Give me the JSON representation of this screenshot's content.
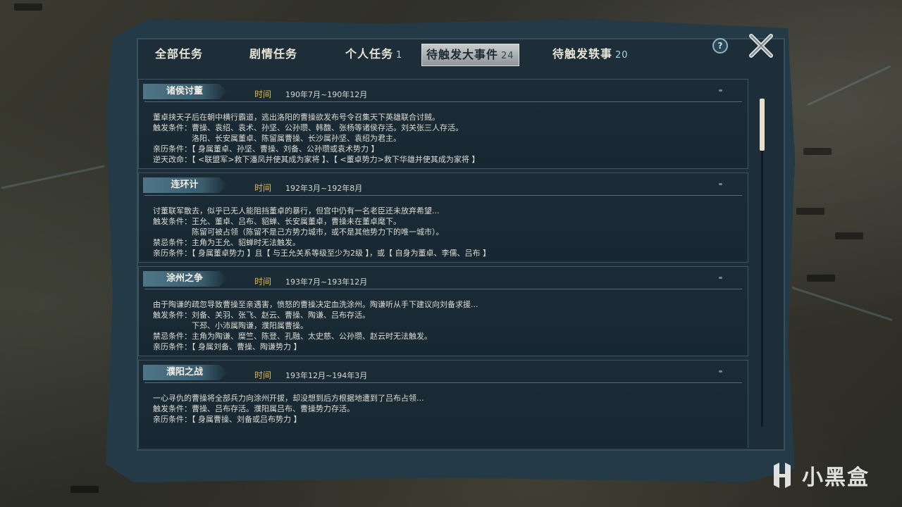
{
  "tabs": [
    {
      "label": "全部任务",
      "count": ""
    },
    {
      "label": "剧情任务",
      "count": ""
    },
    {
      "label": "个人任务",
      "count": "1"
    },
    {
      "label": "待触发大事件",
      "count": "24",
      "active": true
    },
    {
      "label": "待触发轶事",
      "count": "20"
    }
  ],
  "help_label": "?",
  "time_label": "时间",
  "events": [
    {
      "title": "诸侯讨董",
      "time": "190年7月~190年12月",
      "lines": [
        "董卓挟天子后在朝中横行霸道，逃出洛阳的曹操欲发布号令召集天下英雄联合讨贼。",
        "触发条件：曹操、袁绍、袁术、孙坚、公孙瓒、韩馥、张杨等诸侯存活。刘关张三人存活。",
        "　　　　　洛阳、长安属董卓、陈留属曹操、长沙属孙坚、袁绍为君主。",
        "亲历条件：【 身属董卓、孙坚、曹操、刘备、公孙瓒或袁术势力 】",
        "逆天改命：【 <联盟军>救下潘凤并使其成为家将 】、【 <董卓势力>救下华雄并使其成为家将 】"
      ]
    },
    {
      "title": "连环计",
      "time": "192年3月~192年8月",
      "lines": [
        "讨董联军散去，似乎已无人能阻挡董卓的暴行，但宫中仍有一名老臣还未放弃希望...",
        "触发条件：王允、董卓、吕布、貂蝉、长安属董卓，曹操未在董卓麾下。",
        "　　　　　陈留可被占领（陈留不是己方势力城市，或不是其他势力下的唯一城市）。",
        "禁忌条件：主角为王允、貂蝉时无法触发。",
        "亲历条件：【 身属董卓势力 】且【 与王允关系等级至少为2级 】，或【 自身为董卓、李儒、吕布 】"
      ]
    },
    {
      "title": "涂州之争",
      "time": "193年7月~193年12月",
      "lines": [
        "由于陶谦的疏忽导致曹操至亲遇害，愤怒的曹操决定血洗涂州。陶谦听从手下建议向刘备求援...",
        "触发条件：刘备、关羽、张飞、赵云、曹操、陶谦、吕布存活。",
        "　　　　　下邳、小沛属陶谦，濮阳属曹操。",
        "禁忌条件：主角为陶谦、糜竺、陈登、孔融、太史慈、公孙瓒、赵云时无法触发。",
        "亲历条件：【 身属刘备、曹操、陶谦势力 】"
      ]
    },
    {
      "title": "濮阳之战",
      "time": "193年12月~194年3月",
      "lines": [
        "一心寻仇的曹操将全部兵力向涂州开拔，却没想到后方根据地遭到了吕布占领...",
        "触发条件：曹操、吕布存活。濮阳属吕布、曹操势力存活。",
        "亲历条件：【 身属曹操、刘备或吕布势力 】"
      ]
    }
  ],
  "watermark": "小黑盒"
}
